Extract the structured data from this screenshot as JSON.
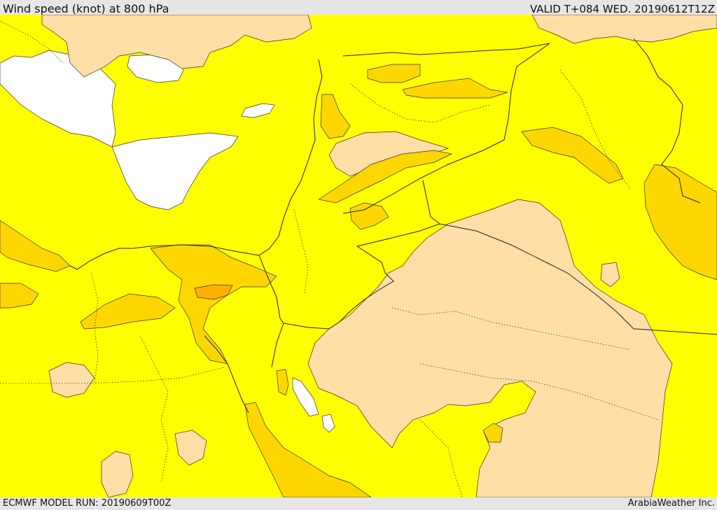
{
  "header": {
    "title": "Wind speed (knot) at 800 hPa",
    "valid": "VALID T+084 WED. 20190612T12Z"
  },
  "footer": {
    "model_run": "ECMWF MODEL RUN: 20190609T00Z",
    "credit": "ArabiaWeather Inc."
  },
  "map": {
    "colors": {
      "below_threshold": "#ffffff",
      "band_low": "#ffff00",
      "band_mid": "#ffdfa6",
      "band_high": "#ffd700",
      "band_peak": "#ffb000",
      "border_line": "#222222"
    }
  }
}
